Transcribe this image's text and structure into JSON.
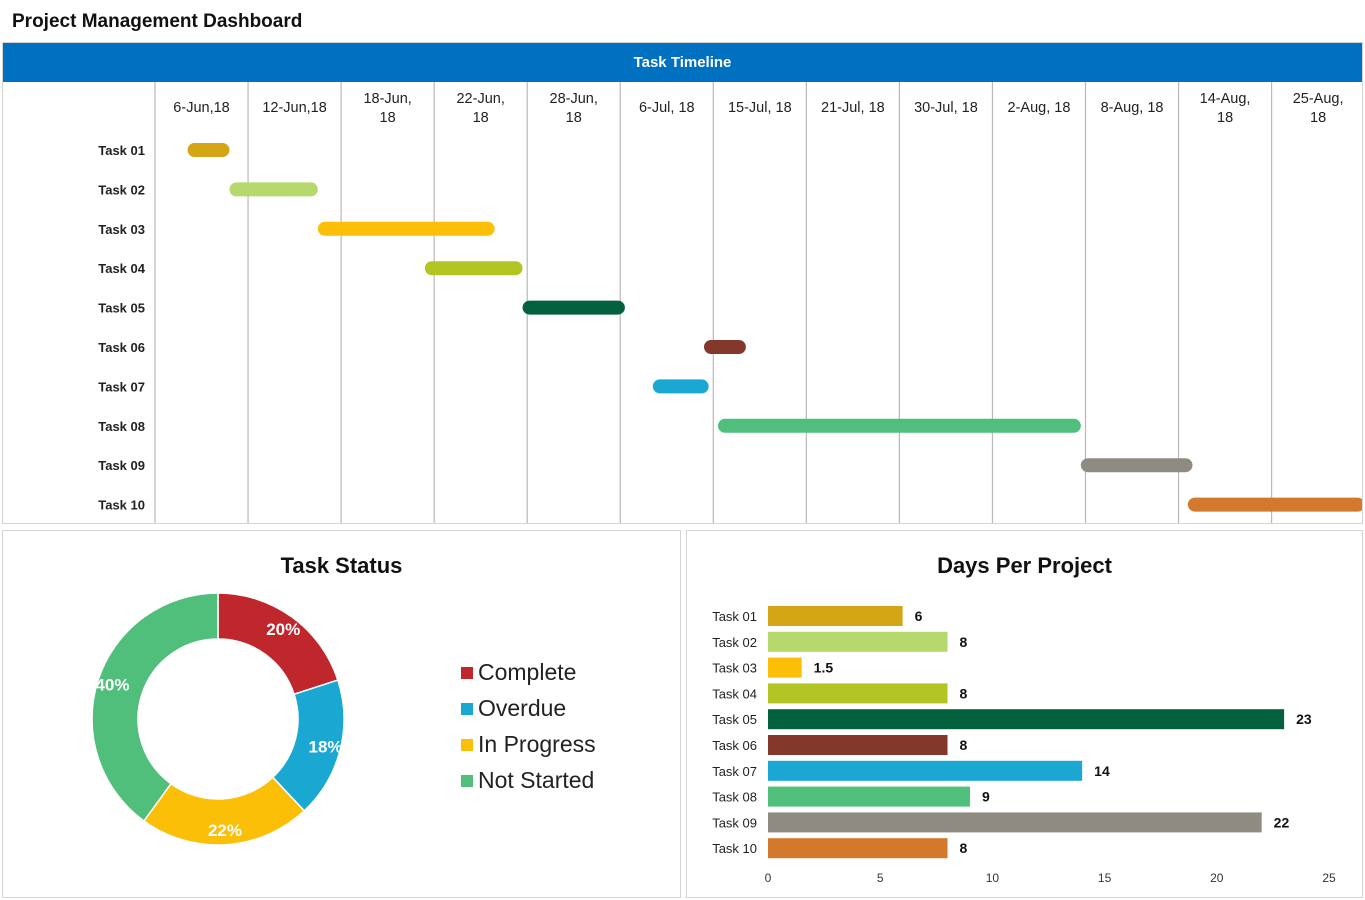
{
  "dashboard_title": "Project Management Dashboard",
  "colors": {
    "banner": "#0070c0",
    "tasks": [
      "#d4a514",
      "#b5d96c",
      "#fbbf08",
      "#b2c522",
      "#04613f",
      "#84372b",
      "#1aa7d1",
      "#4fbf7b",
      "#8f8b83",
      "#d3792d"
    ],
    "status": [
      "#c0272d",
      "#1aa7d1",
      "#fbbf08",
      "#4fbf7b"
    ]
  },
  "chart_data": [
    {
      "type": "gantt",
      "title": "Task Timeline",
      "columns": [
        "6-Jun,18",
        "12-Jun,18",
        "18-Jun,\n18",
        "22-Jun,\n18",
        "28-Jun,\n18",
        "6-Jul, 18",
        "15-Jul, 18",
        "21-Jul, 18",
        "30-Jul, 18",
        "2-Aug, 18",
        "8-Aug, 18",
        "14-Aug,\n18",
        "25-Aug,\n18"
      ],
      "tasks": [
        {
          "name": "Task 01",
          "start": 0.35,
          "end": 0.8
        },
        {
          "name": "Task 02",
          "start": 0.8,
          "end": 1.75
        },
        {
          "name": "Task 03",
          "start": 1.75,
          "end": 3.65
        },
        {
          "name": "Task 04",
          "start": 2.9,
          "end": 3.95
        },
        {
          "name": "Task 05",
          "start": 3.95,
          "end": 5.05
        },
        {
          "name": "Task 06",
          "start": 5.9,
          "end": 6.35
        },
        {
          "name": "Task 07",
          "start": 5.35,
          "end": 5.95
        },
        {
          "name": "Task 08",
          "start": 6.05,
          "end": 9.95
        },
        {
          "name": "Task 09",
          "start": 9.95,
          "end": 11.15
        },
        {
          "name": "Task 10",
          "start": 11.1,
          "end": 13.0
        }
      ]
    },
    {
      "type": "pie",
      "title": "Task Status",
      "labels": [
        "Complete",
        "Overdue",
        "In Progress",
        "Not Started"
      ],
      "values": [
        20,
        18,
        22,
        40
      ],
      "value_labels": [
        "20%",
        "18%",
        "22%",
        "40%"
      ],
      "donut": true,
      "legend": "right"
    },
    {
      "type": "bar",
      "orientation": "horizontal",
      "title": "Days Per Project",
      "categories": [
        "Task 01",
        "Task 02",
        "Task 03",
        "Task 04",
        "Task 05",
        "Task 06",
        "Task 07",
        "Task 08",
        "Task 09",
        "Task 10"
      ],
      "values": [
        6,
        8,
        1.5,
        8,
        23,
        8,
        14,
        9,
        22,
        8
      ],
      "value_labels": [
        "6",
        "8",
        "1.5",
        "8",
        "23",
        "8",
        "14",
        "9",
        "22",
        "8"
      ],
      "xlim": [
        0,
        25
      ],
      "xticks": [
        "0",
        "5",
        "10",
        "15",
        "20",
        "25"
      ],
      "grid": false
    }
  ]
}
